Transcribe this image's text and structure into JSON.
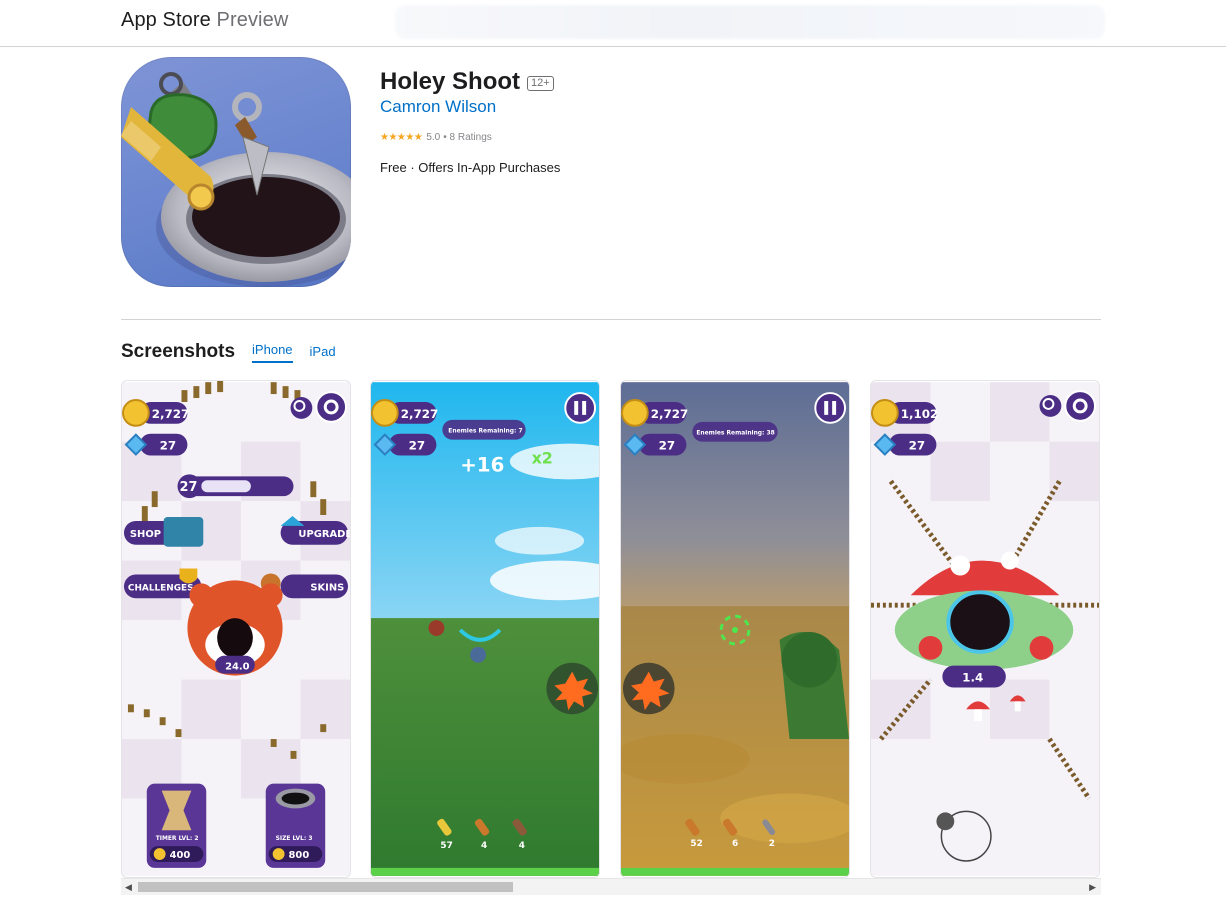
{
  "header": {
    "brand_main": "App Store",
    "brand_sub": "Preview"
  },
  "app": {
    "title": "Holey Shoot",
    "age_rating": "12+",
    "developer": "Camron Wilson",
    "stars": "★★★★★",
    "rating_value": "5.0",
    "rating_count": "• 8 Ratings",
    "price": "Free · Offers In-App Purchases"
  },
  "screenshots": {
    "title": "Screenshots",
    "tabs": [
      {
        "label": "iPhone",
        "active": true
      },
      {
        "label": "iPad",
        "active": false
      }
    ],
    "shot1": {
      "coins": "2,727",
      "gems": "27",
      "level": "27",
      "shop": "SHOP",
      "upgrade": "UPGRADE",
      "challenges": "CHALLENGES",
      "skins": "SKINS",
      "hole_size": "24.0",
      "timer_label": "TIMER LVL: 2",
      "timer_cost": "400",
      "size_label": "SIZE LVL: 3",
      "size_cost": "800"
    },
    "shot2": {
      "coins": "2,727",
      "gems": "27",
      "enemies": "Enemies Remaining: 7",
      "score_popup": "+16",
      "multiplier": "x2",
      "ammo": [
        "57",
        "4",
        "4"
      ]
    },
    "shot3": {
      "coins": "2,727",
      "gems": "27",
      "enemies": "Enemies Remaining: 38",
      "ammo": [
        "52",
        "6",
        "2"
      ]
    },
    "shot4": {
      "coins": "1,102",
      "gems": "27",
      "hole_size": "1.4"
    }
  },
  "colors": {
    "link": "#0070c9",
    "star": "#f5a623",
    "hud_purple": "#4b2d86"
  },
  "icons": [
    "app-icon",
    "coin-icon",
    "gem-icon",
    "gear-icon",
    "magnifier-icon",
    "pause-icon",
    "explosion-icon",
    "crosshair-icon",
    "joystick-icon"
  ]
}
